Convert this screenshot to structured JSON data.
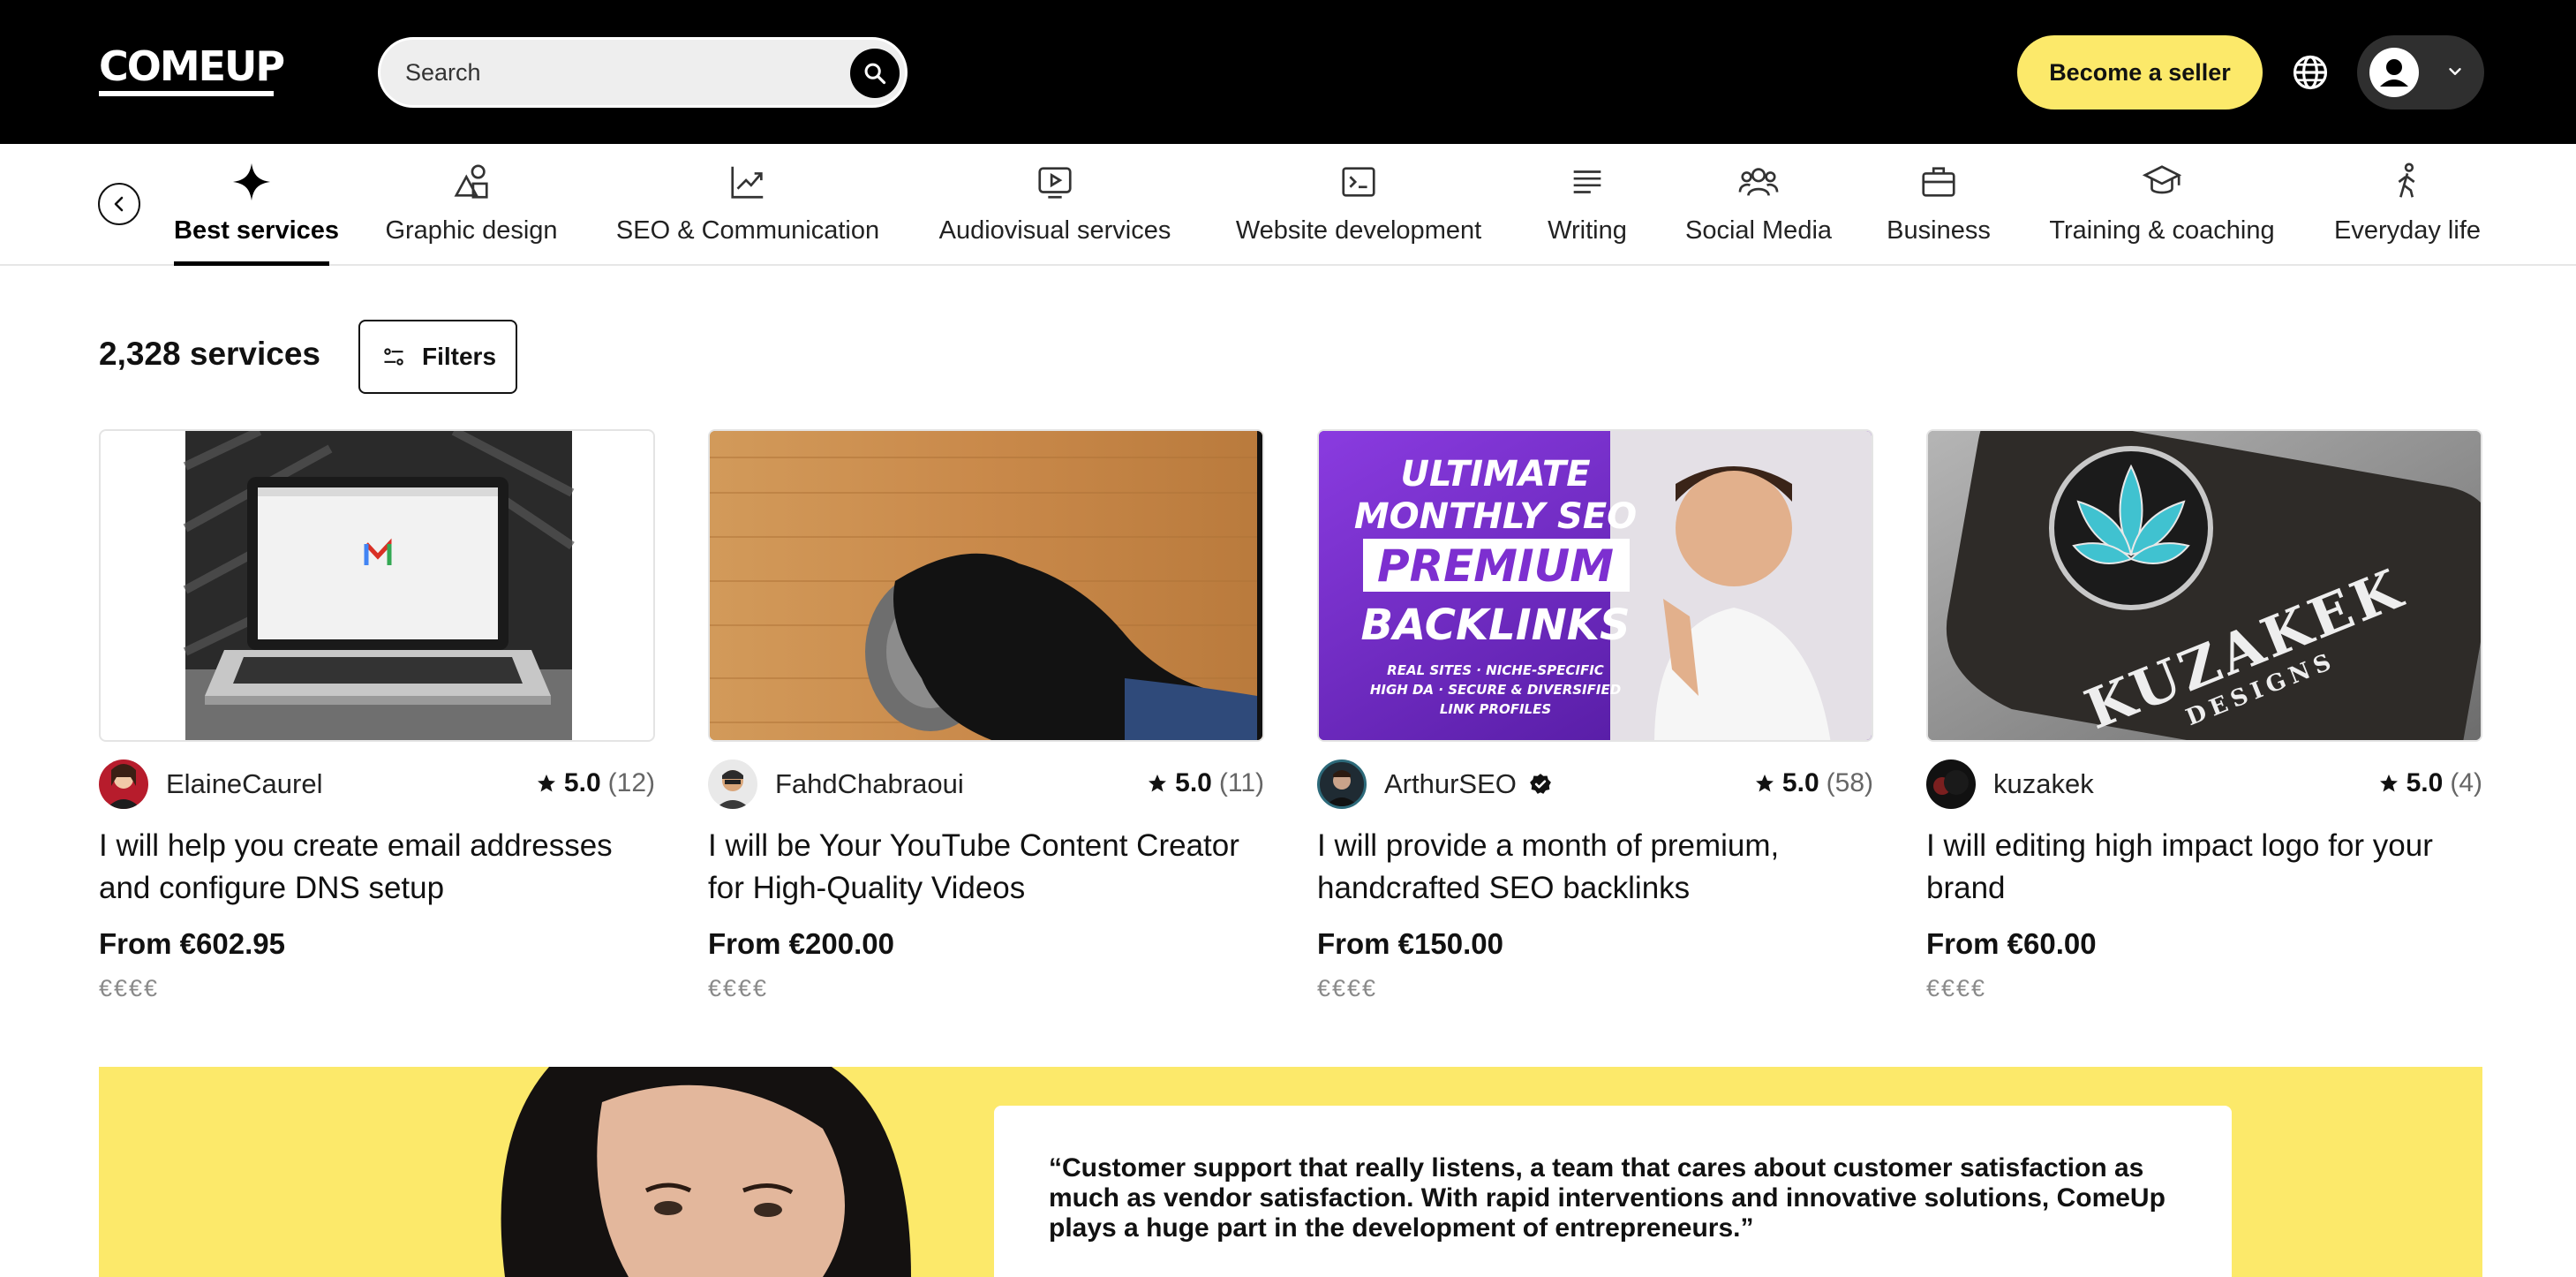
{
  "header": {
    "logo_text": "COMEUP",
    "search_placeholder": "Search",
    "become_seller_label": "Become a seller"
  },
  "categories": [
    {
      "label": "Best services",
      "icon": "sparkle-icon",
      "active": true
    },
    {
      "label": "Graphic design",
      "icon": "shapes-icon"
    },
    {
      "label": "SEO & Communication",
      "icon": "trend-chart-icon"
    },
    {
      "label": "Audiovisual services",
      "icon": "video-play-icon"
    },
    {
      "label": "Website development",
      "icon": "terminal-icon"
    },
    {
      "label": "Writing",
      "icon": "text-lines-icon"
    },
    {
      "label": "Social Media",
      "icon": "users-icon"
    },
    {
      "label": "Business",
      "icon": "briefcase-icon"
    },
    {
      "label": "Training & coaching",
      "icon": "graduation-cap-icon"
    },
    {
      "label": "Everyday life",
      "icon": "walking-person-icon"
    }
  ],
  "results": {
    "count_label": "2,328 services",
    "filters_label": "Filters"
  },
  "services": [
    {
      "seller": "ElaineCaurel",
      "rating": "5.0",
      "reviews": "(12)",
      "title": "I will help you create email addresses and configure DNS setup",
      "price": "From €602.95",
      "tier": "€€€€"
    },
    {
      "seller": "FahdChabraoui",
      "rating": "5.0",
      "reviews": "(11)",
      "title": "I will be Your YouTube Content Creator for High-Quality Videos",
      "price": "From €200.00",
      "tier": "€€€€"
    },
    {
      "seller": "ArthurSEO",
      "verified": true,
      "rating": "5.0",
      "reviews": "(58)",
      "title": "I will provide a month of premium, handcrafted SEO backlinks",
      "price": "From €150.00",
      "tier": "€€€€",
      "thumb_text": {
        "line1": "ULTIMATE",
        "line2": "MONTHLY SEO",
        "line3": "PREMIUM",
        "line4": "BACKLINKS",
        "small1": "REAL SITES · NICHE-SPECIFIC",
        "small2": "HIGH DA · SECURE & DIVERSIFIED",
        "small3": "LINK PROFILES"
      }
    },
    {
      "seller": "kuzakek",
      "rating": "5.0",
      "reviews": "(4)",
      "title": "I will editing high impact logo for your brand",
      "price": "From €60.00",
      "tier": "€€€€",
      "thumb_text": {
        "brand": "KUZAKEK",
        "sub": "DESIGNS"
      }
    }
  ],
  "testimonial": {
    "quote": "“Customer support that really listens, a team that cares about customer satisfaction as much as vendor satisfaction. With rapid interventions and innovative solutions, ComeUp plays a huge part in the development of entrepreneurs.”"
  },
  "colors": {
    "header_bg": "#000000",
    "accent_yellow": "#fce96a",
    "seo_purple": "#7d2fd0"
  }
}
